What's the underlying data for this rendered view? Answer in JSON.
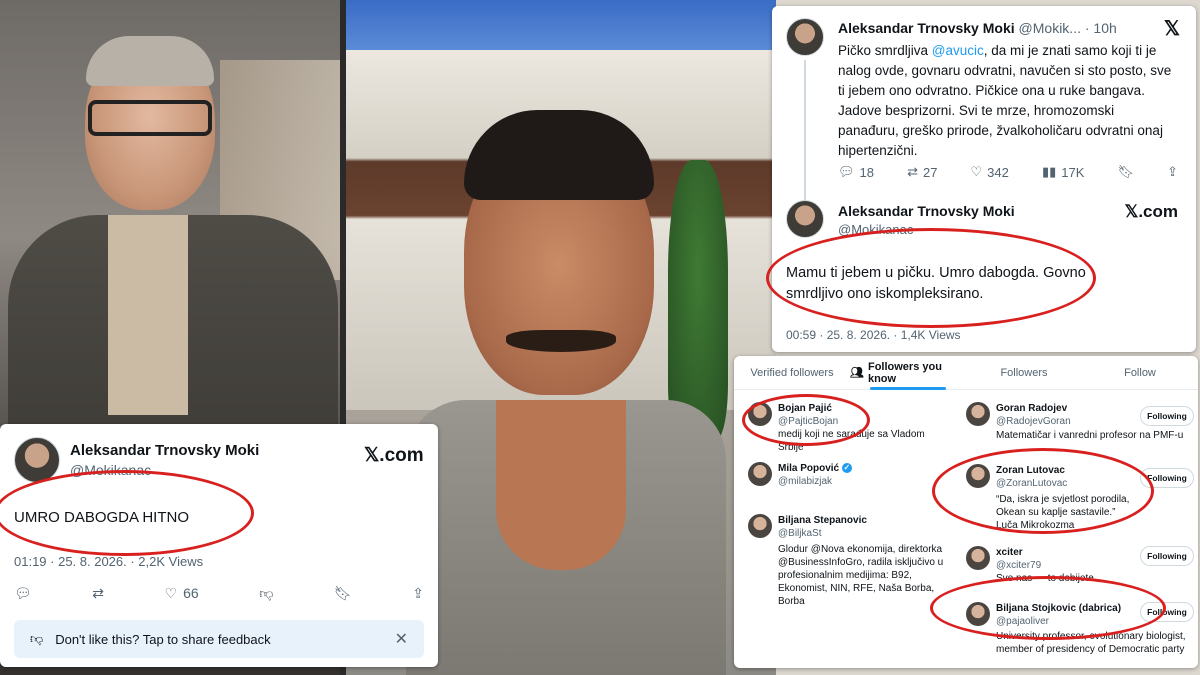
{
  "card_bottom_left": {
    "name": "Aleksandar Trnovsky Moki",
    "handle": "@Mokikanac",
    "brand": "𝕏.com",
    "text": "UMRO DABOGDA HITNO",
    "meta": "01:19 · 25. 8. 2026. · 2,2K Views",
    "likes": "66",
    "feedback": "Don't like this? Tap to share feedback"
  },
  "card_top_right": {
    "name": "Aleksandar Trnovsky Moki",
    "handle": "@Mokik...",
    "time": "· 10h",
    "tweet_parts": [
      "Pičko smrdljiva ",
      "@avucic",
      ", da mi je znati samo koji ti je nalog ovde, govnaru odvratni, navučen si sto posto, sve ti jebem ono odvratno. Pičkice ona u ruke bangava. Jadove besprizorni. Svi te mrze, hromozomski panađuru, greško prirode, žvalkoholičaru odvratni onaj hipertenzični."
    ],
    "replies": "18",
    "reposts": "27",
    "likes": "342",
    "views": "17K",
    "name2": "Aleksandar Trnovsky Moki",
    "handle2": "@Mokikanac",
    "brand": "𝕏.com",
    "tweet2": "Mamu ti jebem u pičku. Umro dabogda. Govno smrdljivo ono iskompleksirano.",
    "meta2": "00:59 · 25. 8. 2026. · 1,4K Views"
  },
  "followers": {
    "tabs": [
      "Verified followers",
      "Followers you know",
      "Followers",
      "Follow"
    ],
    "follow_label": "Following",
    "left": [
      {
        "name": "Bojan Pajić",
        "handle": "@PajticBojan",
        "bio": "medij koji ne sarađuje sa Vladom Srbije"
      },
      {
        "name": "Mila Popović",
        "handle": "@milabizjak",
        "bio": ""
      },
      {
        "name": "Biljana Stepanovic",
        "handle": "@BiljkaSt",
        "bio": "Glodur @Nova ekonomija, direktorka @BusinessInfoGro, radila isključivo u profesionalnim medijima: B92, Ekonomist, NIN, RFE, Naša Borba, Borba"
      }
    ],
    "right": [
      {
        "name": "Goran Radojev",
        "handle": "@RadojevGoran",
        "bio": "Matematičar i vanredni profesor na PMF-u"
      },
      {
        "name": "Zoran Lutovac",
        "handle": "@ZoranLutovac",
        "bio": "“Da, iskra je svjetlost porodila, Okean su kaplje sastavile.” Luča Mikrokozma"
      },
      {
        "name": "xciter",
        "handle": "@xciter79",
        "bio": "Sve nas — to dobijete"
      },
      {
        "name": "Biljana Stojkovic (dabrica)",
        "handle": "@pajaoliver",
        "bio": "University professor, evolutionary biologist, member of presidency of Democratic party"
      }
    ]
  }
}
